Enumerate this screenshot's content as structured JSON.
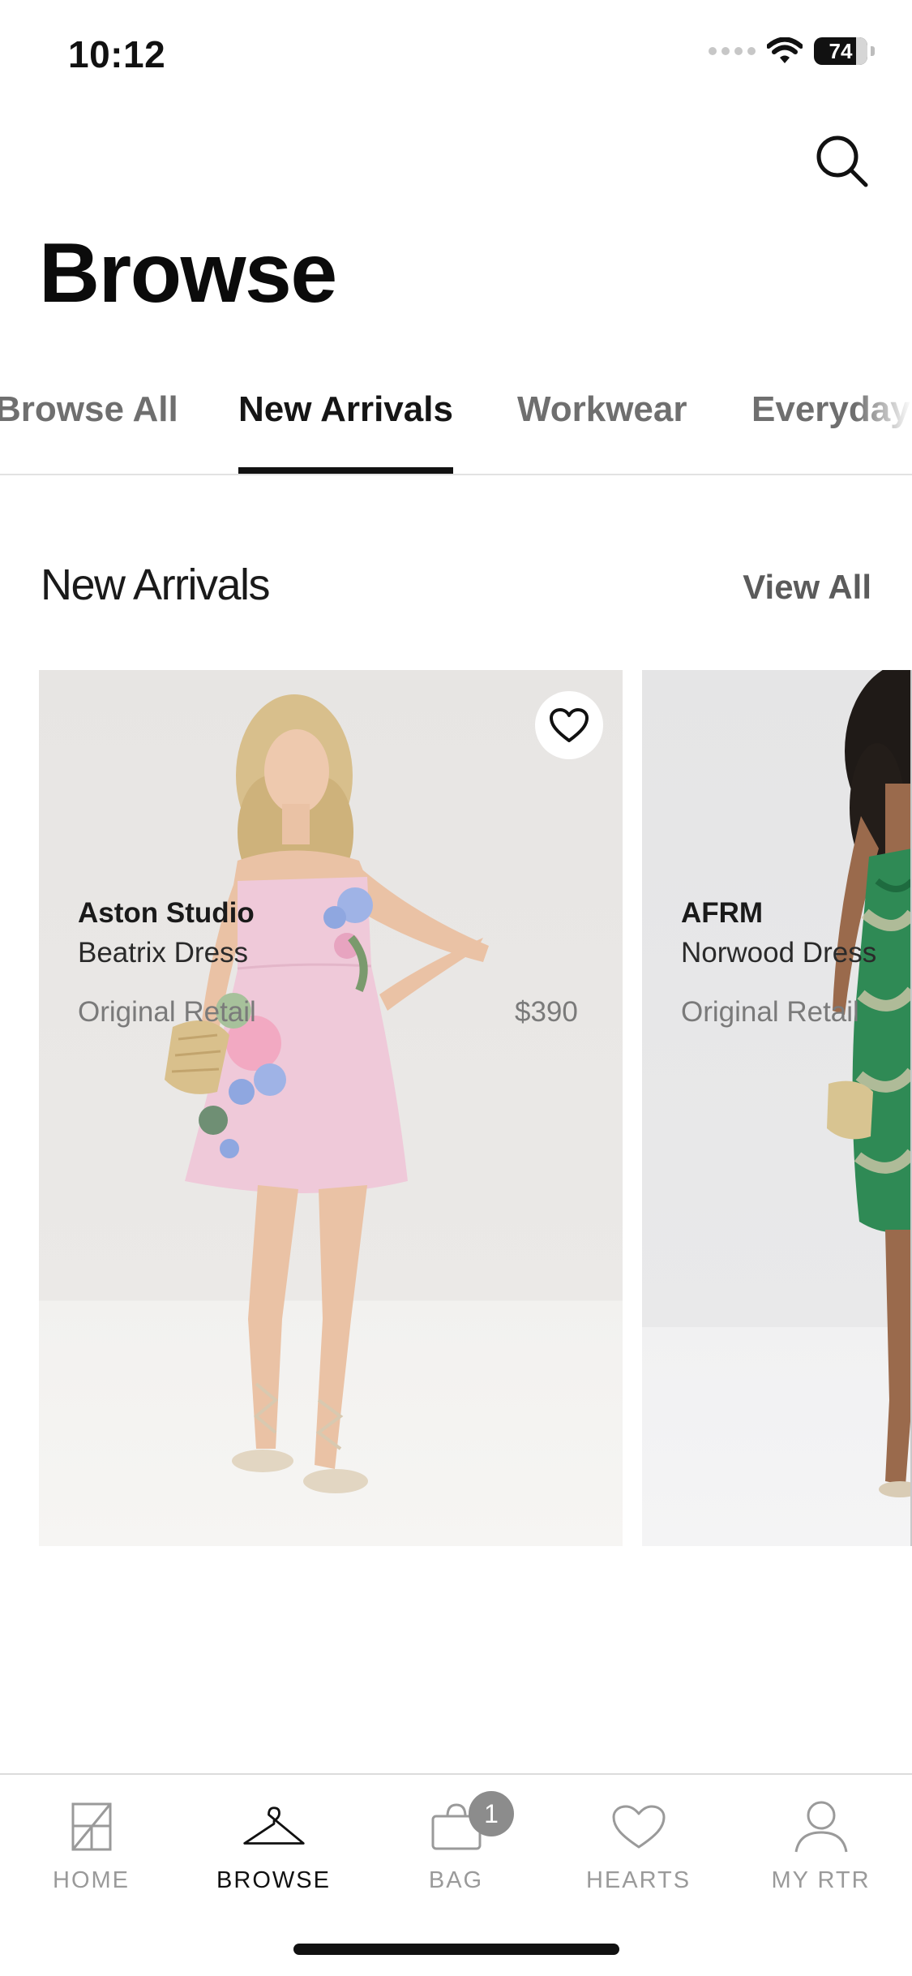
{
  "status_bar": {
    "time": "10:12",
    "battery": "74"
  },
  "header": {
    "title": "Browse",
    "search_icon": "search-icon"
  },
  "tabs": [
    {
      "label": "Browse All",
      "active": false
    },
    {
      "label": "New Arrivals",
      "active": true
    },
    {
      "label": "Workwear",
      "active": false
    },
    {
      "label": "Everyday",
      "active": false
    }
  ],
  "section": {
    "title": "New Arrivals",
    "view_all_label": "View All"
  },
  "products": [
    {
      "brand": "Aston Studio",
      "name": "Beatrix Dress",
      "retail_label": "Original Retail",
      "price": "$390",
      "image": "model in pink strapless floral mini dress"
    },
    {
      "brand": "AFRM",
      "name": "Norwood Dress",
      "retail_label": "Original Retail",
      "price": "",
      "image": "model in green printed halter dress"
    }
  ],
  "bottom_nav": [
    {
      "label": "HOME",
      "icon": "home-icon",
      "active": false
    },
    {
      "label": "BROWSE",
      "icon": "hanger-icon",
      "active": true
    },
    {
      "label": "BAG",
      "icon": "bag-icon",
      "active": false,
      "badge": "1"
    },
    {
      "label": "HEARTS",
      "icon": "heart-icon",
      "active": false
    },
    {
      "label": "MY RTR",
      "icon": "person-icon",
      "active": false
    }
  ],
  "colors": {
    "text": "#111111",
    "muted": "#7a7a7a",
    "badge": "#8c8c8c",
    "divider": "#e2e2e2"
  }
}
